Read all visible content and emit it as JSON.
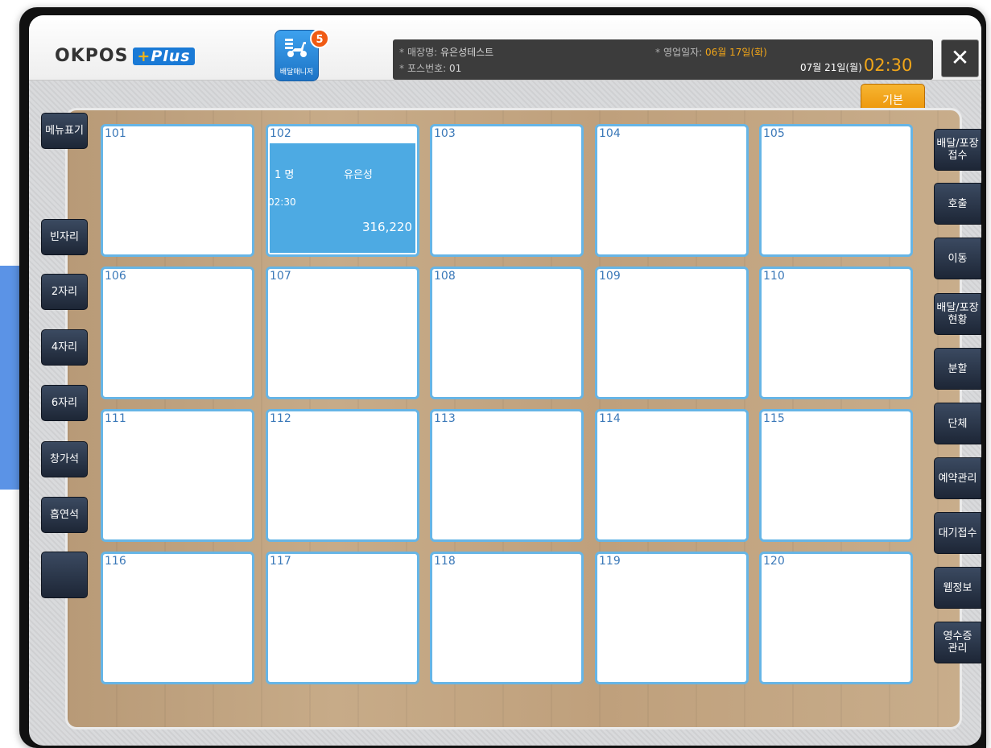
{
  "header": {
    "logo_main": "OKPOS",
    "logo_plus": "Plus",
    "delivery_manager": {
      "label": "배달매니저",
      "badge": "5"
    },
    "store_label": "매장명",
    "store_name": "유은성테스트",
    "pos_label": "포스번호",
    "pos_number": "01",
    "business_date_label": "영업일자",
    "business_date": "06월 17일(화)",
    "current_date": "07월 21일(월)",
    "current_time": "02:30",
    "close": "✕"
  },
  "basic_button": "기본",
  "left_buttons": [
    {
      "id": "menu-display",
      "label": "메뉴표기"
    },
    {
      "id": "empty-seat",
      "label": "빈자리"
    },
    {
      "id": "two-seat",
      "label": "2자리"
    },
    {
      "id": "four-seat",
      "label": "4자리"
    },
    {
      "id": "six-seat",
      "label": "6자리"
    },
    {
      "id": "window-seat",
      "label": "창가석"
    },
    {
      "id": "smoking-seat",
      "label": "흡연석"
    },
    {
      "id": "blank",
      "label": ""
    }
  ],
  "right_buttons": [
    {
      "id": "delivery-takeout-receive",
      "line1": "배달/포장",
      "line2": "접수"
    },
    {
      "id": "call",
      "line1": "호출",
      "line2": ""
    },
    {
      "id": "move",
      "line1": "이동",
      "line2": ""
    },
    {
      "id": "delivery-takeout-status",
      "line1": "배달/포장",
      "line2": "현황"
    },
    {
      "id": "split",
      "line1": "분할",
      "line2": ""
    },
    {
      "id": "group",
      "line1": "단체",
      "line2": ""
    },
    {
      "id": "reservation",
      "line1": "예약관리",
      "line2": ""
    },
    {
      "id": "waiting",
      "line1": "대기접수",
      "line2": ""
    },
    {
      "id": "web-info",
      "line1": "웹정보",
      "line2": ""
    },
    {
      "id": "receipt",
      "line1": "영수증",
      "line2": "관리"
    }
  ],
  "tables": [
    {
      "num": "101"
    },
    {
      "num": "102",
      "occupied": true,
      "guests": "1 명",
      "host": "유은성",
      "time": "02:30",
      "amount": "316,220"
    },
    {
      "num": "103"
    },
    {
      "num": "104"
    },
    {
      "num": "105"
    },
    {
      "num": "106"
    },
    {
      "num": "107"
    },
    {
      "num": "108"
    },
    {
      "num": "109"
    },
    {
      "num": "110"
    },
    {
      "num": "111"
    },
    {
      "num": "112"
    },
    {
      "num": "113"
    },
    {
      "num": "114"
    },
    {
      "num": "115"
    },
    {
      "num": "116"
    },
    {
      "num": "117"
    },
    {
      "num": "118"
    },
    {
      "num": "119"
    },
    {
      "num": "120"
    }
  ],
  "colors": {
    "accent_blue": "#4daae3",
    "orange": "#f2a618",
    "dark_button": "#1d2636"
  }
}
